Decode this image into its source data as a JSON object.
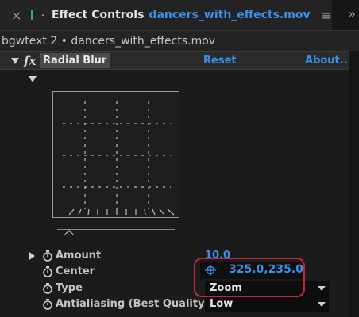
{
  "panel": {
    "close_glyph": "×",
    "title": "Effect Controls",
    "file_name": "dancers_with_effects.mov",
    "menu_glyph": "≡",
    "overflow_glyph": "»",
    "source_line": "bgwtext 2 • dancers_with_effects.mov",
    "accent_color": "#3b8fe6",
    "label_color": "#3aa28b"
  },
  "effect": {
    "badge": "fx",
    "name": "Radial Blur",
    "reset_label": "Reset",
    "about_label": "About..."
  },
  "params": {
    "amount": {
      "label": "Amount",
      "value": "10.0"
    },
    "center": {
      "label": "Center",
      "value": "325.0,235.0"
    },
    "type": {
      "label": "Type",
      "value": "Zoom"
    },
    "antialiasing": {
      "label": "Antialiasing (Best Quality)",
      "value": "Low"
    }
  },
  "highlight_color": "#c8233a"
}
